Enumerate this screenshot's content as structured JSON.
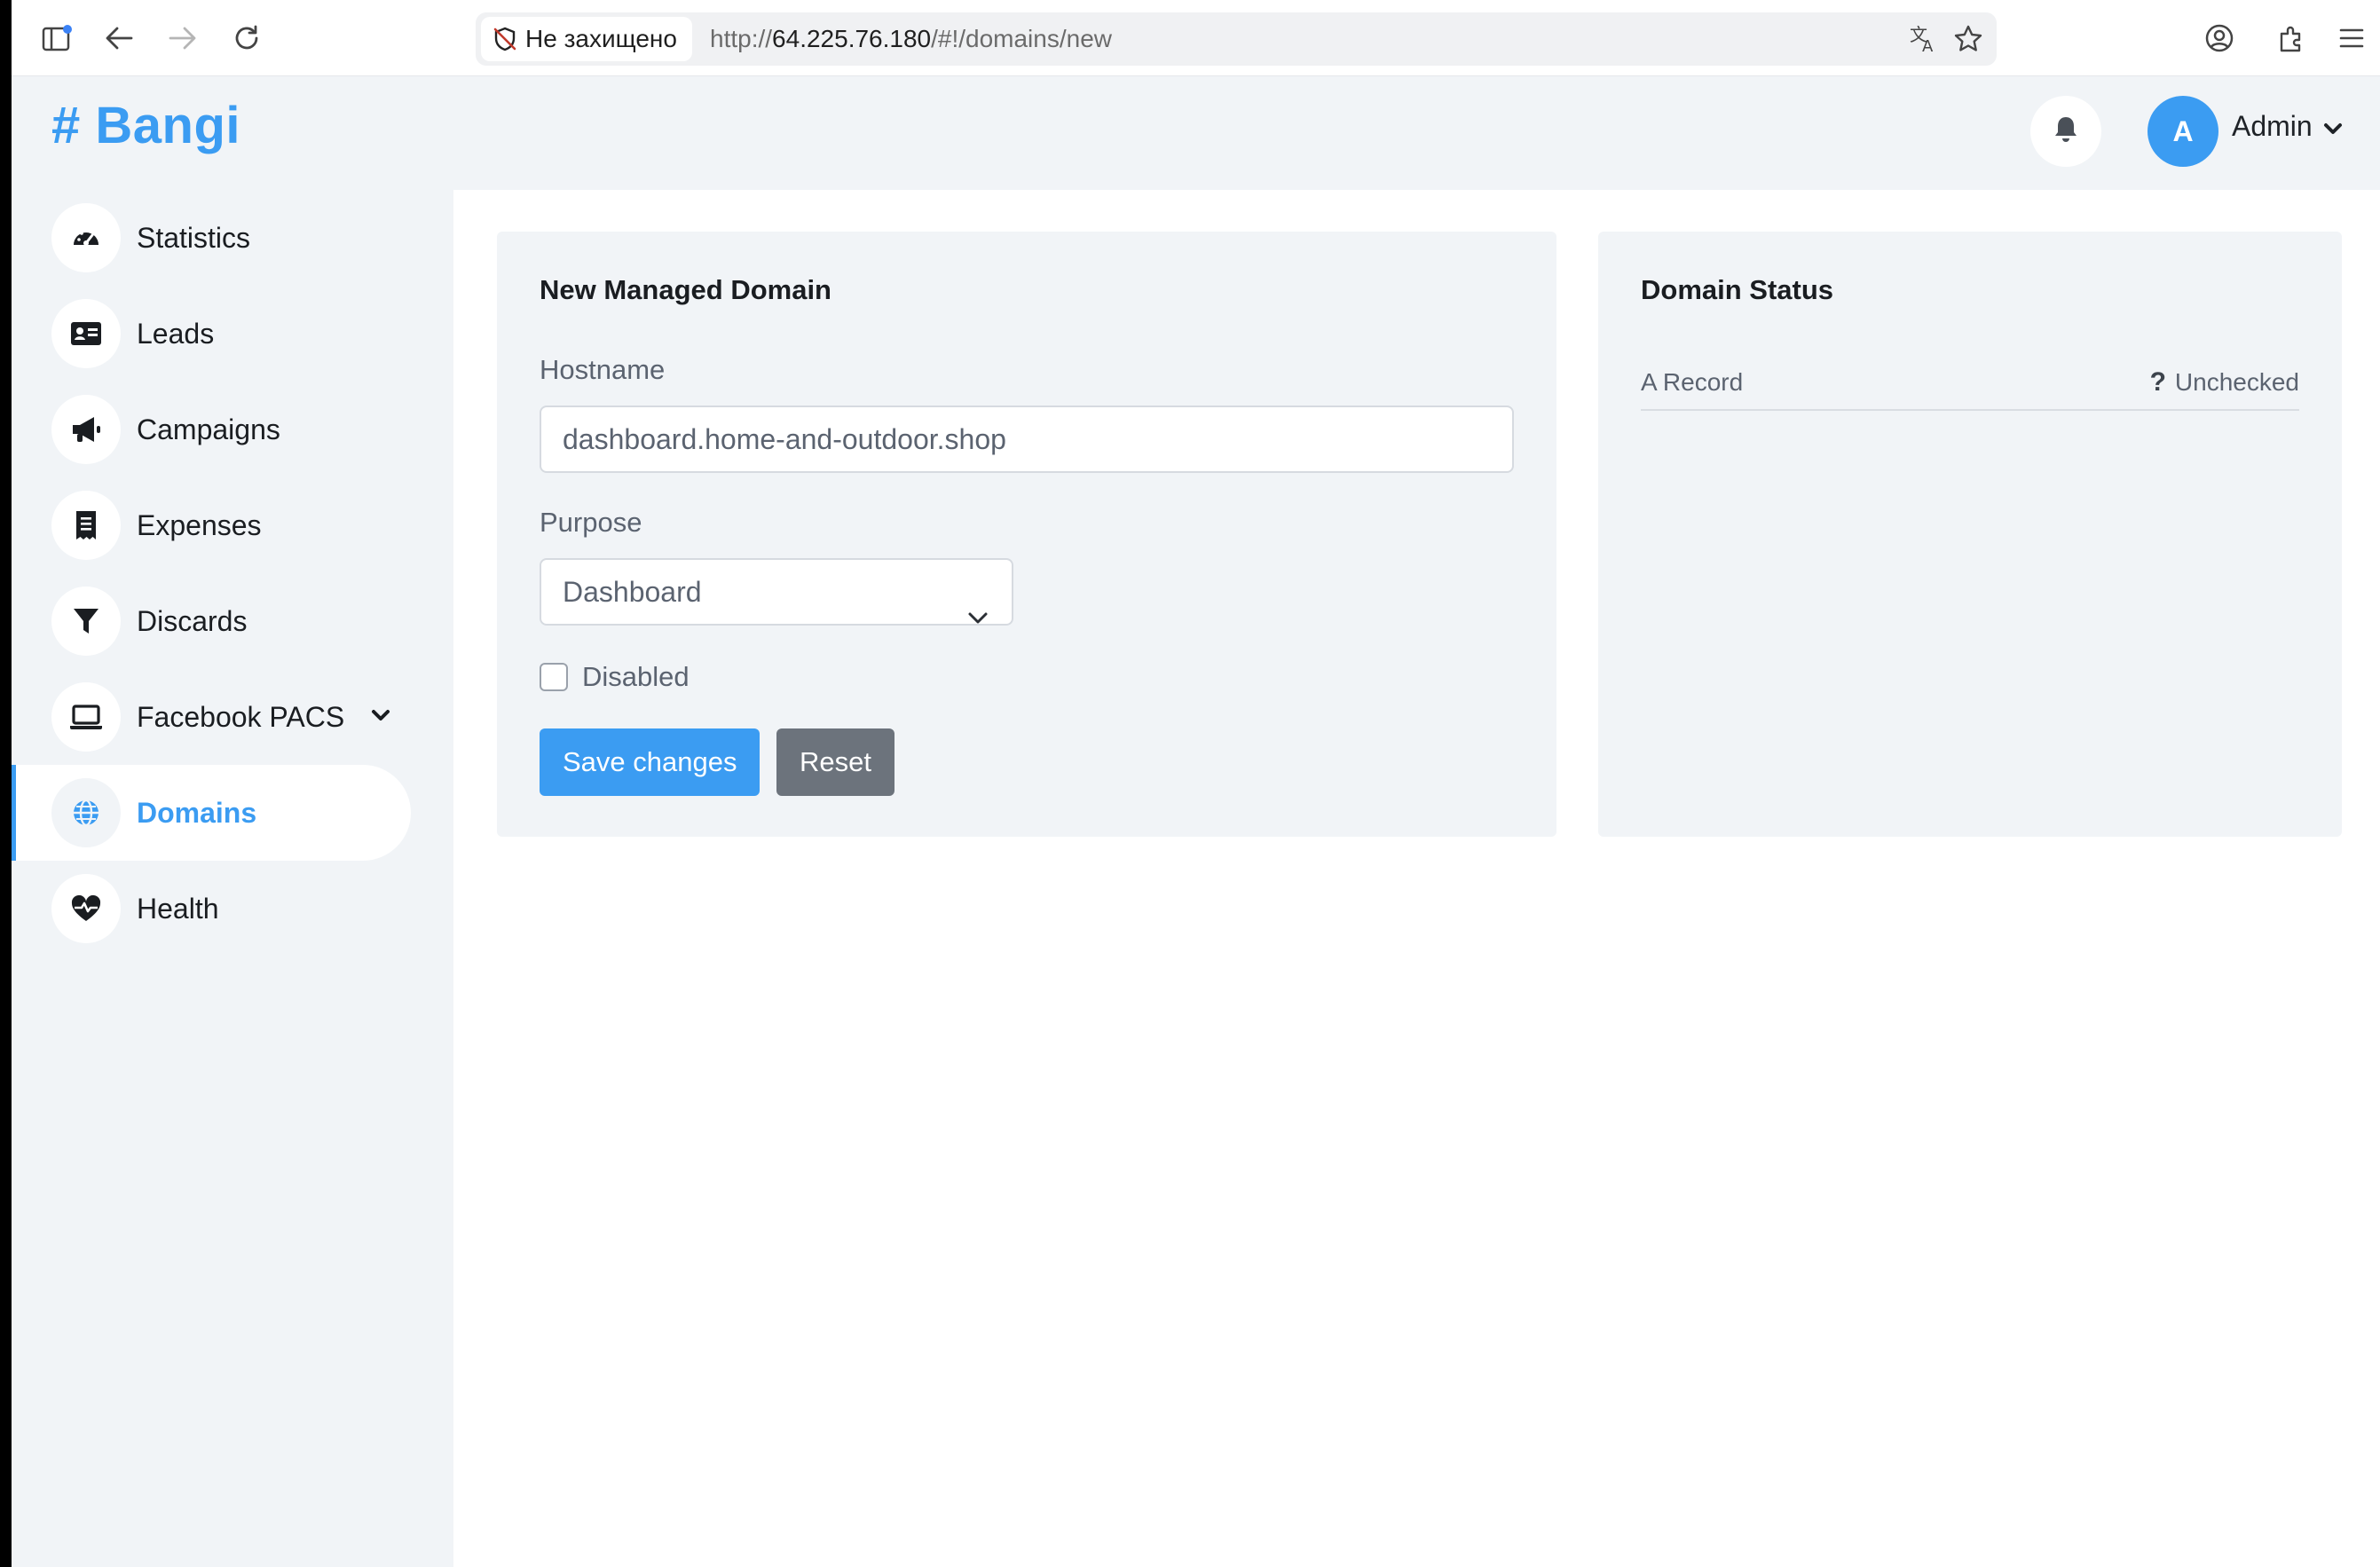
{
  "browser": {
    "security_label": "Не захищено",
    "url_scheme": "http://",
    "url_host": "64.225.76.180",
    "url_path": "/#!/domains/new"
  },
  "app": {
    "brand": "# Bangi",
    "user": {
      "initial": "A",
      "name": "Admin"
    }
  },
  "sidebar": {
    "items": [
      {
        "label": "Statistics",
        "icon": "gauge-icon"
      },
      {
        "label": "Leads",
        "icon": "id-card-icon"
      },
      {
        "label": "Campaigns",
        "icon": "megaphone-icon"
      },
      {
        "label": "Expenses",
        "icon": "receipt-icon"
      },
      {
        "label": "Discards",
        "icon": "filter-icon"
      },
      {
        "label": "Facebook PACS",
        "icon": "laptop-icon"
      },
      {
        "label": "Domains",
        "icon": "globe-icon"
      },
      {
        "label": "Health",
        "icon": "heart-pulse-icon"
      }
    ],
    "active": "Domains"
  },
  "form": {
    "title": "New Managed Domain",
    "hostname_label": "Hostname",
    "hostname_value": "dashboard.home-and-outdoor.shop",
    "purpose_label": "Purpose",
    "purpose_value": "Dashboard",
    "disabled_label": "Disabled",
    "save_label": "Save changes",
    "reset_label": "Reset"
  },
  "status": {
    "title": "Domain Status",
    "rows": [
      {
        "label": "A Record",
        "value": "Unchecked"
      }
    ]
  },
  "colors": {
    "accent": "#3b9cf2",
    "secondary": "#6c737c",
    "panel": "#f1f4f7"
  }
}
